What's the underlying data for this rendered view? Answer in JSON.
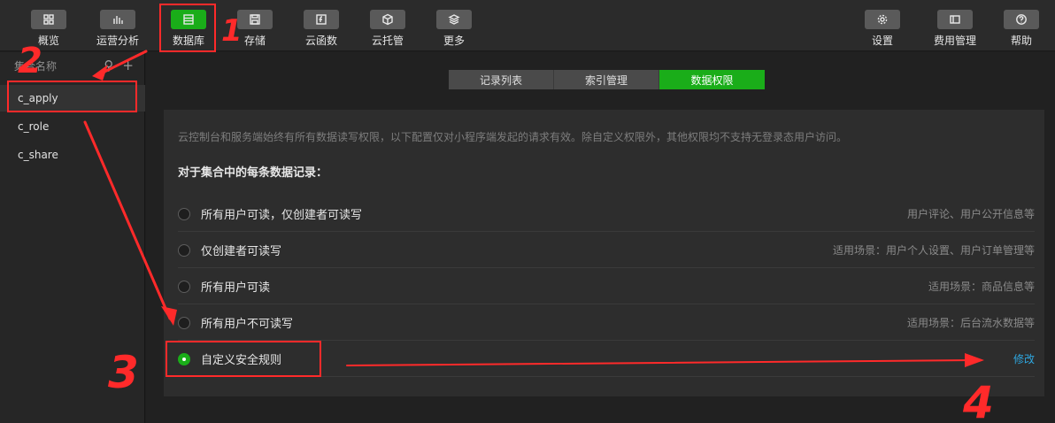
{
  "toolbar": {
    "left": [
      {
        "label": "概览",
        "icon": "grid-icon"
      },
      {
        "label": "运营分析",
        "icon": "bar-chart-icon"
      },
      {
        "label": "数据库",
        "icon": "database-icon",
        "active": true
      },
      {
        "label": "存储",
        "icon": "save-icon"
      },
      {
        "label": "云函数",
        "icon": "function-icon"
      },
      {
        "label": "云托管",
        "icon": "cube-icon"
      },
      {
        "label": "更多",
        "icon": "layers-icon"
      }
    ],
    "right": [
      {
        "label": "设置",
        "icon": "gear-icon"
      },
      {
        "label": "费用管理",
        "icon": "billing-icon"
      },
      {
        "label": "帮助",
        "icon": "help-icon"
      }
    ]
  },
  "sidebar": {
    "header": "集合名称",
    "items": [
      "c_apply",
      "c_role",
      "c_share"
    ]
  },
  "main": {
    "tabs": [
      "记录列表",
      "索引管理",
      "数据权限"
    ],
    "description": "云控制台和服务端始终有所有数据读写权限，以下配置仅对小程序端发起的请求有效。除自定义权限外，其他权限均不支持无登录态用户访问。",
    "subtitle": "对于集合中的每条数据记录：",
    "options": [
      {
        "label": "所有用户可读，仅创建者可读写",
        "hint": "用户评论、用户公开信息等"
      },
      {
        "label": "仅创建者可读写",
        "hint": "适用场景：用户个人设置、用户订单管理等"
      },
      {
        "label": "所有用户可读",
        "hint": "适用场景：商品信息等"
      },
      {
        "label": "所有用户不可读写",
        "hint": "适用场景：后台流水数据等"
      },
      {
        "label": "自定义安全规则",
        "link": "修改"
      }
    ]
  },
  "annotations": [
    "1",
    "2",
    "3",
    "4"
  ],
  "colors": {
    "accent": "#1aad19",
    "link": "#2ea7e0",
    "annotation": "#ff2a2a"
  }
}
